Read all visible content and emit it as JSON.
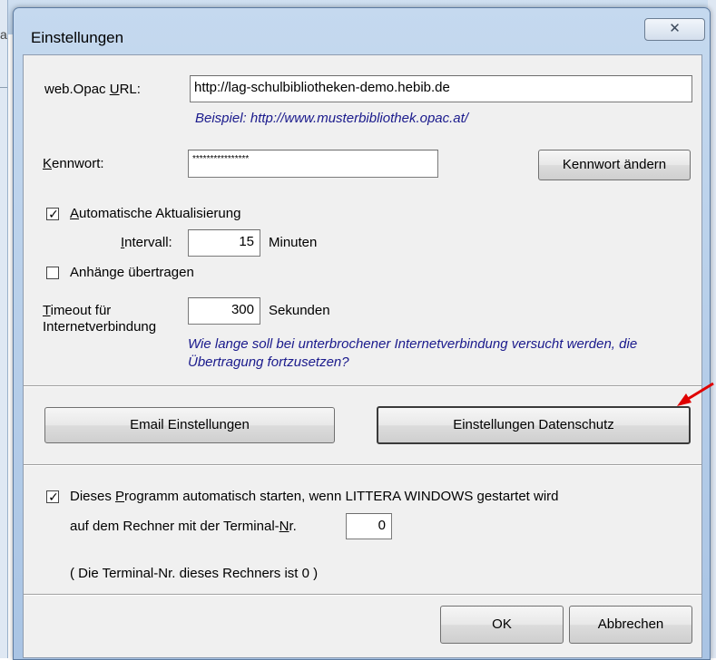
{
  "dialog": {
    "title": "Einstellungen",
    "close_label": "X"
  },
  "background": {
    "left_text": "a"
  },
  "opac": {
    "label_pre": "web.Opac ",
    "label_accel": "U",
    "label_post": "RL:",
    "url_value": "http://lag-schulbibliotheken-demo.hebib.de",
    "example": "Beispiel:  http://www.musterbibliothek.opac.at/"
  },
  "password": {
    "label_accel": "K",
    "label_post": "ennwort:",
    "value": "****************",
    "change_button": "Kennwort ändern"
  },
  "auto_update": {
    "checked": true,
    "label_accel": "A",
    "label_post": "utomatische Aktualisierung",
    "interval_accel": "I",
    "interval_post": "ntervall:",
    "interval_value": "15",
    "interval_unit": "Minuten"
  },
  "attachments": {
    "checked": false,
    "label": "Anhänge übertragen"
  },
  "timeout": {
    "label_line1_accel": "T",
    "label_line1_post": "imeout für",
    "label_line2": "Internetverbindung",
    "value": "300",
    "unit": "Sekunden",
    "hint": "Wie lange soll bei unterbrochener Internetverbindung versucht werden, die Übertragung fortzusetzen?"
  },
  "buttons": {
    "email_settings": "Email Einstellungen",
    "privacy_settings": "Einstellungen Datenschutz",
    "ok": "OK",
    "cancel": "Abbrechen"
  },
  "autostart": {
    "checked": true,
    "line1_pre": "Dieses ",
    "line1_accel": "P",
    "line1_post": "rogramm automatisch starten, wenn LITTERA WINDOWS gestartet wird",
    "line2_pre": "auf dem Rechner mit der Terminal-",
    "line2_accel": "N",
    "line2_post": "r.",
    "terminal_value": "0",
    "info": "( Die Terminal-Nr. dieses Rechners ist 0 )"
  },
  "colors": {
    "accent_arrow": "#e00000",
    "hint_text": "#1a1a8c"
  }
}
